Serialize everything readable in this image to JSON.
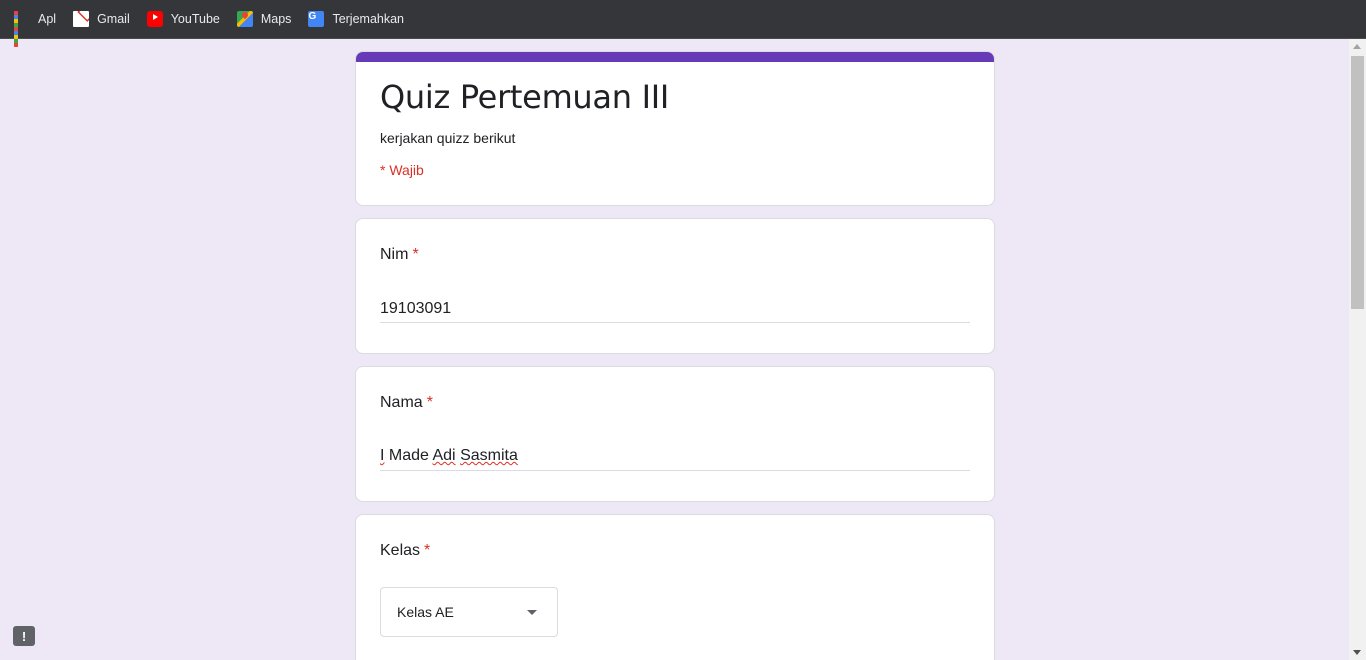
{
  "bookmarks": [
    {
      "label": "Apl",
      "icon": "apps-grid-icon"
    },
    {
      "label": "Gmail",
      "icon": "gmail-icon"
    },
    {
      "label": "YouTube",
      "icon": "youtube-icon"
    },
    {
      "label": "Maps",
      "icon": "maps-icon"
    },
    {
      "label": "Terjemahkan",
      "icon": "translate-icon"
    }
  ],
  "form": {
    "title": "Quiz Pertemuan III",
    "description": "kerjakan quizz berikut",
    "required_note": "* Wajib",
    "accent_color": "#673ab7",
    "background_color": "#ede7f6"
  },
  "questions": {
    "nim": {
      "label": "Nim",
      "required_mark": "*",
      "value": "19103091"
    },
    "nama": {
      "label": "Nama",
      "required_mark": "*",
      "value_parts": [
        "I",
        " Made ",
        "Adi",
        " ",
        "Sasmita"
      ]
    },
    "kelas": {
      "label": "Kelas",
      "required_mark": "*",
      "selected": "Kelas AE"
    }
  },
  "feedback_icon": "report-icon"
}
